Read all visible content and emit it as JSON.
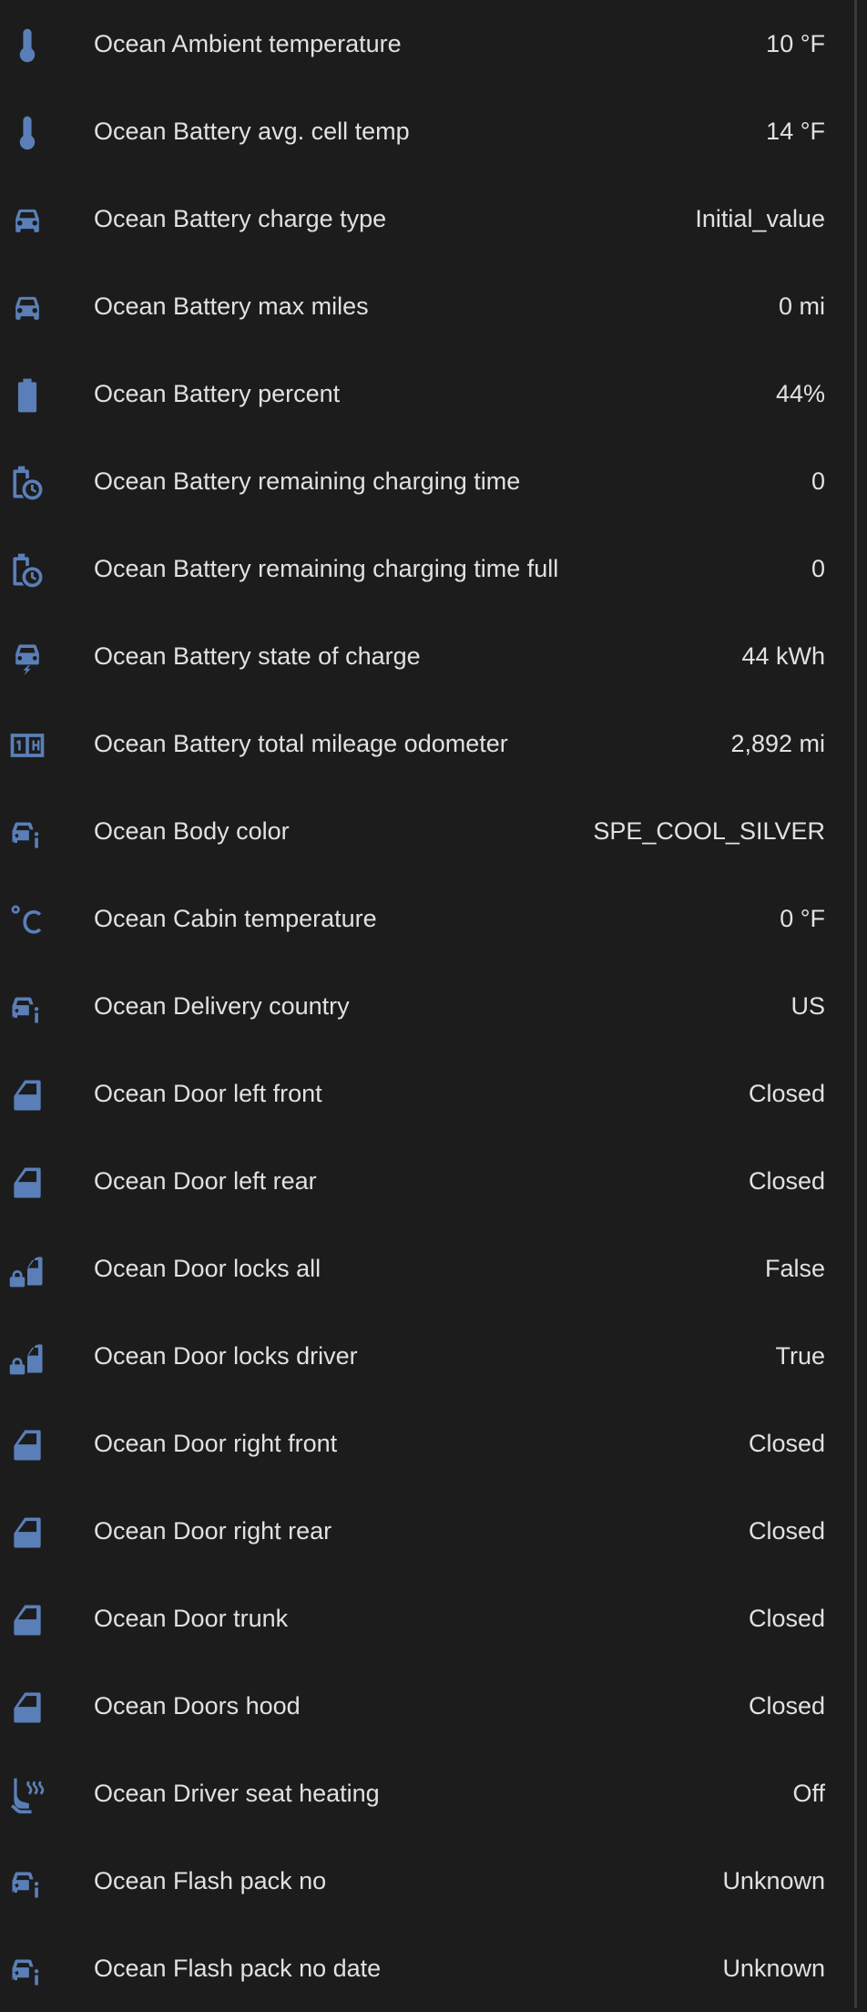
{
  "colors": {
    "background": "#1c1c1c",
    "icon": "#5a7fb8",
    "text": "#e1e1e1"
  },
  "entities": [
    {
      "icon": "thermometer-icon",
      "name": "Ocean Ambient temperature",
      "value": "10 °F"
    },
    {
      "icon": "thermometer-icon",
      "name": "Ocean Battery avg. cell temp",
      "value": "14 °F"
    },
    {
      "icon": "car-icon",
      "name": "Ocean Battery charge type",
      "value": "Initial_value"
    },
    {
      "icon": "car-icon",
      "name": "Ocean Battery max miles",
      "value": "0 mi"
    },
    {
      "icon": "battery-icon",
      "name": "Ocean Battery percent",
      "value": "44%"
    },
    {
      "icon": "battery-clock-icon",
      "name": "Ocean Battery remaining charging time",
      "value": "0"
    },
    {
      "icon": "battery-clock-icon",
      "name": "Ocean Battery remaining charging time full",
      "value": "0"
    },
    {
      "icon": "car-electric-icon",
      "name": "Ocean Battery state of charge",
      "value": "44 kWh"
    },
    {
      "icon": "counter-icon",
      "name": "Ocean Battery total mileage odometer",
      "value": "2,892 mi"
    },
    {
      "icon": "car-info-icon",
      "name": "Ocean Body color",
      "value": "SPE_COOL_SILVER"
    },
    {
      "icon": "temperature-celsius-icon",
      "name": "Ocean Cabin temperature",
      "value": "0 °F"
    },
    {
      "icon": "car-info-icon",
      "name": "Ocean Delivery country",
      "value": "US"
    },
    {
      "icon": "car-door-icon",
      "name": "Ocean Door left front",
      "value": "Closed"
    },
    {
      "icon": "car-door-icon",
      "name": "Ocean Door left rear",
      "value": "Closed"
    },
    {
      "icon": "car-door-lock-icon",
      "name": "Ocean Door locks all",
      "value": "False"
    },
    {
      "icon": "car-door-lock-icon",
      "name": "Ocean Door locks driver",
      "value": "True"
    },
    {
      "icon": "car-door-icon",
      "name": "Ocean Door right front",
      "value": "Closed"
    },
    {
      "icon": "car-door-icon",
      "name": "Ocean Door right rear",
      "value": "Closed"
    },
    {
      "icon": "car-door-icon",
      "name": "Ocean Door trunk",
      "value": "Closed"
    },
    {
      "icon": "car-door-icon",
      "name": "Ocean Doors hood",
      "value": "Closed"
    },
    {
      "icon": "car-seat-heater-icon",
      "name": "Ocean Driver seat heating",
      "value": "Off"
    },
    {
      "icon": "car-info-icon",
      "name": "Ocean Flash pack no",
      "value": "Unknown"
    },
    {
      "icon": "car-info-icon",
      "name": "Ocean Flash pack no date",
      "value": "Unknown"
    }
  ]
}
